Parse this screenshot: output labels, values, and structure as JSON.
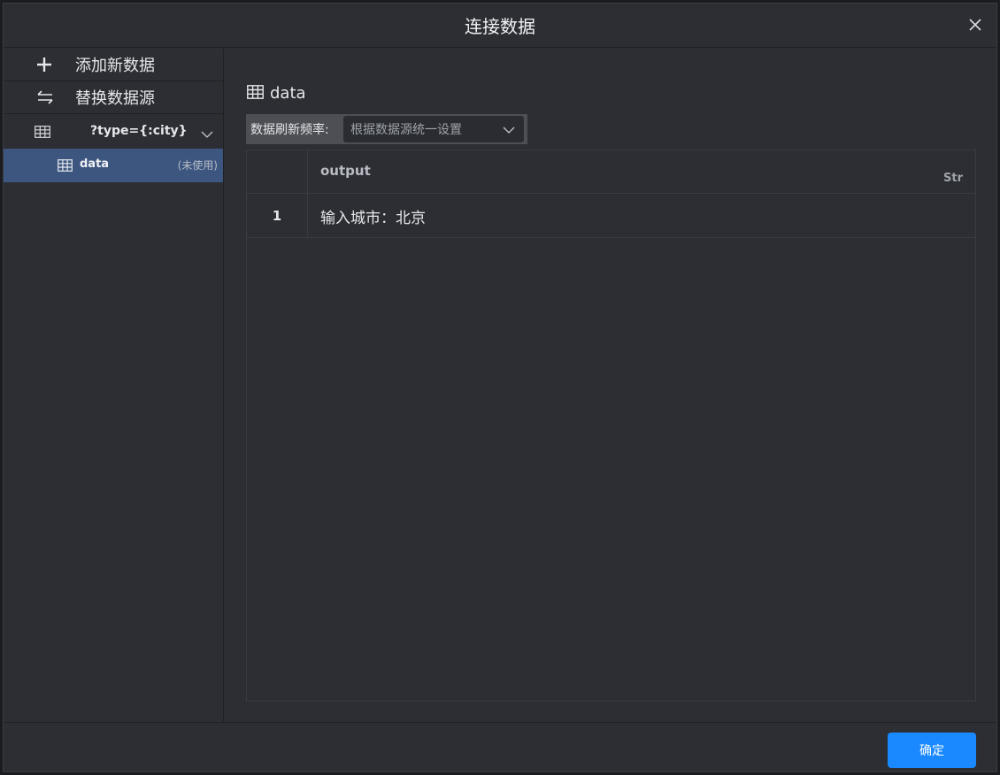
{
  "dialog": {
    "title": "连接数据",
    "close_icon": "close-icon"
  },
  "sidebar": {
    "actions": [
      {
        "icon": "plus-icon",
        "label": "添加新数据"
      },
      {
        "icon": "swap-icon",
        "label": "替换数据源"
      }
    ],
    "source": {
      "icon": "table-icon",
      "label": "?type={:city}",
      "expand_icon": "chevron-down-icon"
    },
    "tables": [
      {
        "icon": "table-icon",
        "label": "data",
        "status": "(未使用)"
      }
    ]
  },
  "main": {
    "table_title": "data",
    "refresh": {
      "label": "数据刷新频率:",
      "value": "根据数据源统一设置"
    },
    "grid": {
      "columns": [
        {
          "name": "output",
          "type": "Str"
        }
      ],
      "rows": [
        {
          "index": "1",
          "values": [
            "输入城市：北京"
          ]
        }
      ]
    }
  },
  "footer": {
    "ok_label": "确定"
  },
  "colors": {
    "accent": "#1a89ff",
    "selected": "#3c5680",
    "panel": "#2c2e33"
  }
}
